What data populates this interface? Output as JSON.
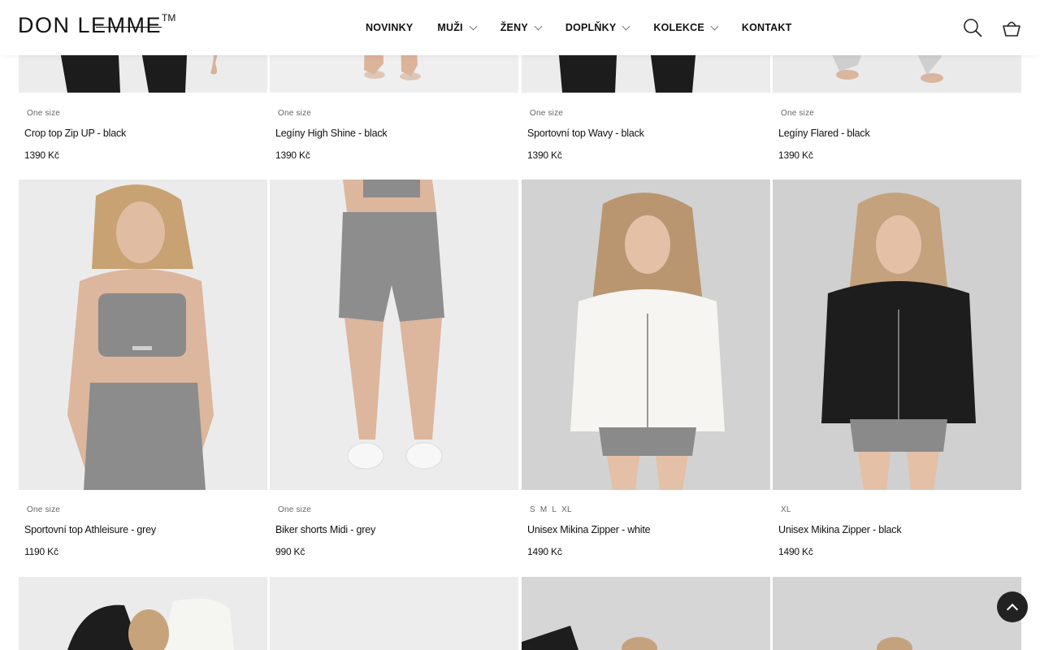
{
  "header": {
    "logo": {
      "part1": "DON L",
      "part2": "EMME",
      "tm": "TM"
    },
    "nav": [
      {
        "label": "NOVINKY",
        "dropdown": false
      },
      {
        "label": "MUŽI",
        "dropdown": true
      },
      {
        "label": "ŽENY",
        "dropdown": true
      },
      {
        "label": "DOPLŇKY",
        "dropdown": true
      },
      {
        "label": "KOLEKCE",
        "dropdown": true
      },
      {
        "label": "KONTAKT",
        "dropdown": false
      }
    ],
    "icons": {
      "search": "search-icon",
      "cart": "basket-icon"
    }
  },
  "products_row1": [
    {
      "sizes": [
        "One size"
      ],
      "name": "Crop top Zip UP - black",
      "price": "1390 Kč",
      "image": "woman-black-leggings"
    },
    {
      "sizes": [
        "One size"
      ],
      "name": "Legíny High Shine - black",
      "price": "1390 Kč",
      "image": "woman-heels-legs"
    },
    {
      "sizes": [
        "One size"
      ],
      "name": "Sportovní top Wavy - black",
      "price": "1390 Kč",
      "image": "woman-black-leggings"
    },
    {
      "sizes": [
        "One size"
      ],
      "name": "Legíny Flared - black",
      "price": "1390 Kč",
      "image": "woman-heels-legs"
    }
  ],
  "products_row2": [
    {
      "sizes": [
        "One size"
      ],
      "name": "Sportovní top Athleisure - grey",
      "price": "1190 Kč",
      "image": "woman-grey-athleisure-set"
    },
    {
      "sizes": [
        "One size"
      ],
      "name": "Biker shorts Midi - grey",
      "price": "990 Kč",
      "image": "grey-biker-shorts"
    },
    {
      "sizes": [
        "S",
        "M",
        "L",
        "XL"
      ],
      "name": "Unisex Mikina Zipper - white",
      "price": "1490 Kč",
      "image": "woman-white-zip-hoodie"
    },
    {
      "sizes": [
        "XL"
      ],
      "name": "Unisex Mikina Zipper - black",
      "price": "1490 Kč",
      "image": "woman-black-zip-hoodie"
    }
  ],
  "products_row3": [
    {
      "image": "woman-black-white-hoodie"
    },
    {
      "image": "studio-grey-background"
    },
    {
      "image": "woman-studio-portrait"
    },
    {
      "image": "woman-studio-portrait"
    }
  ],
  "scroll_top": {
    "icon": "chevron-up-icon"
  },
  "colors": {
    "text": "#111111",
    "muted": "#666666",
    "photo_bg": "#e9e9e9",
    "button": "#222222"
  }
}
